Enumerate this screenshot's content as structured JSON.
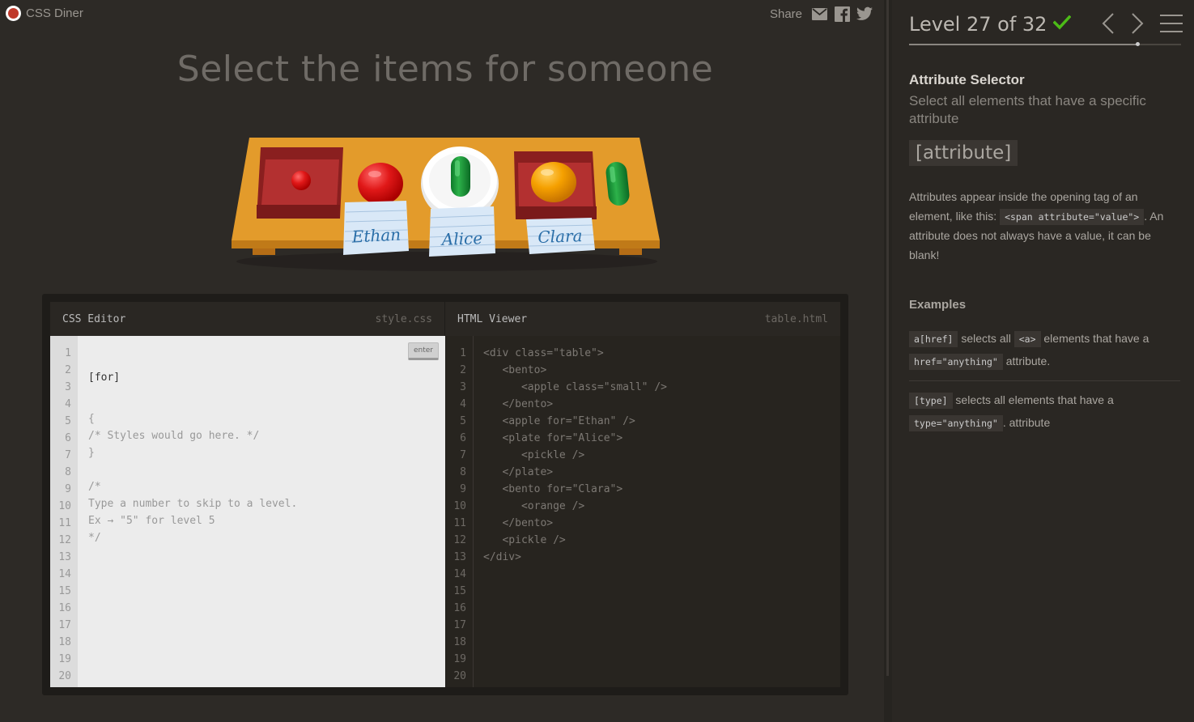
{
  "app": {
    "name": "CSS Diner"
  },
  "share": {
    "label": "Share",
    "icons": [
      "mail-icon",
      "facebook-icon",
      "twitter-icon"
    ]
  },
  "instruction": "Select the items for someone",
  "table": {
    "items": [
      "bento with small apple",
      "apple for Ethan",
      "plate for Alice with pickle",
      "bento for Clara with orange",
      "pickle"
    ],
    "name_tags": [
      "Ethan",
      "Alice",
      "Clara"
    ]
  },
  "css_editor": {
    "title": "CSS Editor",
    "filename": "style.css",
    "input_value": "[for]",
    "enter_label": "enter",
    "lines": [
      "{",
      "/* Styles would go here. */",
      "}",
      "",
      "/*",
      "Type a number to skip to a level.",
      "Ex → \"5\" for level 5",
      "*/"
    ],
    "line_numbers": [
      "1",
      "2",
      "3",
      "4",
      "5",
      "6",
      "7",
      "8",
      "9",
      "10",
      "11",
      "12",
      "13",
      "14",
      "15",
      "16",
      "17",
      "18",
      "19",
      "20"
    ]
  },
  "html_viewer": {
    "title": "HTML Viewer",
    "filename": "table.html",
    "lines": [
      "<div class=\"table\">",
      "   <bento>",
      "      <apple class=\"small\" />",
      "   </bento>",
      "   <apple for=\"Ethan\" />",
      "   <plate for=\"Alice\">",
      "      <pickle />",
      "   </plate>",
      "   <bento for=\"Clara\">",
      "      <orange />",
      "   </bento>",
      "   <pickle />",
      "</div>"
    ],
    "line_numbers": [
      "1",
      "2",
      "3",
      "4",
      "5",
      "6",
      "7",
      "8",
      "9",
      "10",
      "11",
      "12",
      "13",
      "14",
      "15",
      "16",
      "17",
      "18",
      "19",
      "20"
    ]
  },
  "level": {
    "label": "Level 27 of 32",
    "completed": true,
    "progress": 0.84,
    "check_color": "#4cbb17"
  },
  "selector": {
    "name": "Attribute Selector",
    "description": "Select all elements that have a specific attribute",
    "syntax": "[attribute]",
    "hint_part1": "Attributes appear inside the opening tag of an element, like this: ",
    "hint_code": "<span attribute=\"value\">",
    "hint_part2": ". An attribute does not always have a value, it can be blank!"
  },
  "examples": {
    "title": "Examples",
    "ex1": {
      "code1": "a[href]",
      "text1": " selects all ",
      "code2": "<a>",
      "text2": " elements that have a ",
      "code3": "href=\"anything\"",
      "text3": " attribute."
    },
    "ex2": {
      "code1": "[type]",
      "text1": " selects all elements that have a ",
      "code2": "type=\"anything\"",
      "text2": ". attribute"
    }
  },
  "colors": {
    "accent": "#c0392b",
    "table": "#e8a53a",
    "bento": "#a83232"
  }
}
